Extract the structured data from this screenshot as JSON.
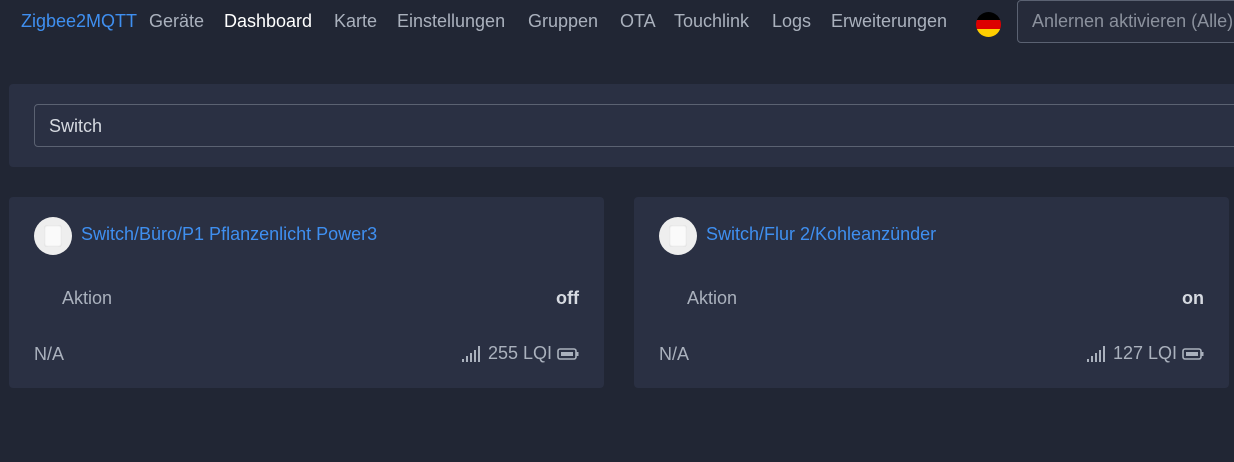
{
  "navbar": {
    "brand": "Zigbee2MQTT",
    "links": [
      "Geräte",
      "Dashboard",
      "Karte",
      "Einstellungen",
      "Gruppen",
      "OTA",
      "Touchlink",
      "Logs",
      "Erweiterungen"
    ],
    "active": "Dashboard",
    "language_flag": "de-flag-icon",
    "permit_join_label": "Anlernen aktivieren (Alle)"
  },
  "filter": {
    "value": "Switch"
  },
  "devices": [
    {
      "name": "Switch/Büro/P1 Pflanzenlicht Power3",
      "feature_label": "Aktion",
      "feature_value": "off",
      "power_source": "N/A",
      "lqi": "255 LQI"
    },
    {
      "name": "Switch/Flur 2/Kohleanzünder",
      "feature_label": "Aktion",
      "feature_value": "on",
      "power_source": "N/A",
      "lqi": "127 LQI"
    }
  ],
  "colors": {
    "background": "#212634",
    "card": "#2a3043",
    "accent": "#3f8ff0"
  }
}
